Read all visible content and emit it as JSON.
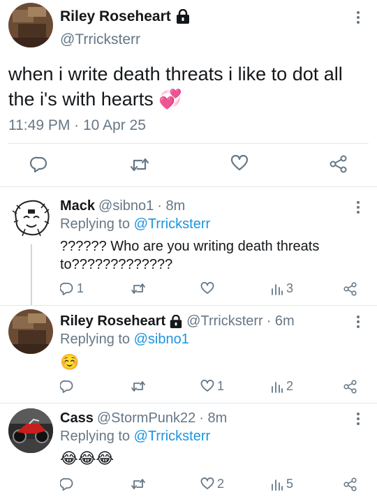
{
  "main_tweet": {
    "author_name": "Riley Roseheart",
    "handle": "@Trricksterr",
    "text": "when i write death threats i like to dot all the i's with hearts 💞",
    "timestamp": "11:49 PM · 10 Apr 25"
  },
  "replies": [
    {
      "author_name": "Mack",
      "handle": "@sibno1",
      "time": "· 8m",
      "replying_prefix": "Replying to ",
      "replying_to": "@Trricksterr",
      "text": "?????? Who are you writing death threats to?????????????",
      "reply_count": "1",
      "like_count": "",
      "views_count": "3"
    },
    {
      "author_name": "Riley Roseheart",
      "handle": "@Trricksterr",
      "time": "· 6m",
      "replying_prefix": "Replying to ",
      "replying_to": "@sibno1",
      "text": "☺️",
      "reply_count": "",
      "like_count": "1",
      "views_count": "2"
    },
    {
      "author_name": "Cass",
      "handle": "@StormPunk22",
      "time": "· 8m",
      "replying_prefix": "Replying to ",
      "replying_to": "@Trricksterr",
      "text": "😂😂😂",
      "reply_count": "",
      "like_count": "2",
      "views_count": "5"
    }
  ],
  "icons": {
    "lock": "lock-icon",
    "more": "more-vertical-icon",
    "reply": "reply-icon",
    "retweet": "retweet-icon",
    "like": "heart-icon",
    "share": "share-icon",
    "views": "analytics-icon"
  },
  "colors": {
    "link_blue": "#1b95e0",
    "secondary_gray": "#657786",
    "divider": "#e1e8ed"
  }
}
